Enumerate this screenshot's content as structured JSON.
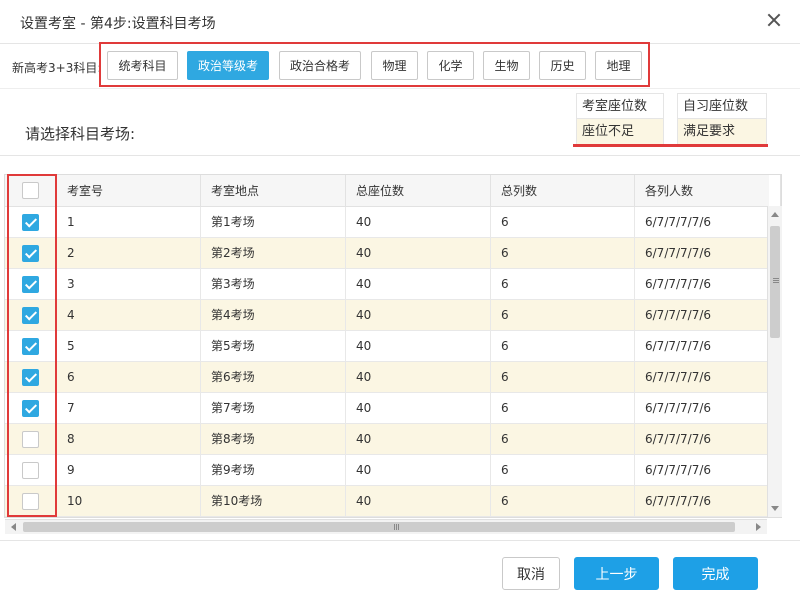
{
  "dialog": {
    "title": "设置考室 - 第4步:设置科目考场"
  },
  "subjects": {
    "label": "新高考3+3科目:",
    "items": [
      {
        "label": "统考科目",
        "active": false
      },
      {
        "label": "政治等级考",
        "active": true
      },
      {
        "label": "政治合格考",
        "active": false
      },
      {
        "label": "物理",
        "active": false
      },
      {
        "label": "化学",
        "active": false
      },
      {
        "label": "生物",
        "active": false
      },
      {
        "label": "历史",
        "active": false
      },
      {
        "label": "地理",
        "active": false
      }
    ]
  },
  "section": {
    "prompt": "请选择科目考场:"
  },
  "legend": [
    {
      "top": "考室座位数",
      "bottom": "座位不足"
    },
    {
      "top": "自习座位数",
      "bottom": "满足要求"
    }
  ],
  "table": {
    "columns": [
      "考室号",
      "考室地点",
      "总座位数",
      "总列数",
      "各列人数"
    ],
    "rows": [
      {
        "checked": true,
        "cells": [
          "1",
          "第1考场",
          "40",
          "6",
          "6/7/7/7/7/6"
        ]
      },
      {
        "checked": true,
        "cells": [
          "2",
          "第2考场",
          "40",
          "6",
          "6/7/7/7/7/6"
        ]
      },
      {
        "checked": true,
        "cells": [
          "3",
          "第3考场",
          "40",
          "6",
          "6/7/7/7/7/6"
        ]
      },
      {
        "checked": true,
        "cells": [
          "4",
          "第4考场",
          "40",
          "6",
          "6/7/7/7/7/6"
        ]
      },
      {
        "checked": true,
        "cells": [
          "5",
          "第5考场",
          "40",
          "6",
          "6/7/7/7/7/6"
        ]
      },
      {
        "checked": true,
        "cells": [
          "6",
          "第6考场",
          "40",
          "6",
          "6/7/7/7/7/6"
        ]
      },
      {
        "checked": true,
        "cells": [
          "7",
          "第7考场",
          "40",
          "6",
          "6/7/7/7/7/6"
        ]
      },
      {
        "checked": false,
        "cells": [
          "8",
          "第8考场",
          "40",
          "6",
          "6/7/7/7/7/6"
        ]
      },
      {
        "checked": false,
        "cells": [
          "9",
          "第9考场",
          "40",
          "6",
          "6/7/7/7/7/6"
        ]
      },
      {
        "checked": false,
        "cells": [
          "10",
          "第10考场",
          "40",
          "6",
          "6/7/7/7/7/6"
        ]
      }
    ]
  },
  "footer": {
    "cancel": "取消",
    "prev": "上一步",
    "done": "完成"
  },
  "colors": {
    "accent": "#2fa8e1",
    "highlight": "#e03a3a",
    "alt_row": "#fbf6e3"
  }
}
